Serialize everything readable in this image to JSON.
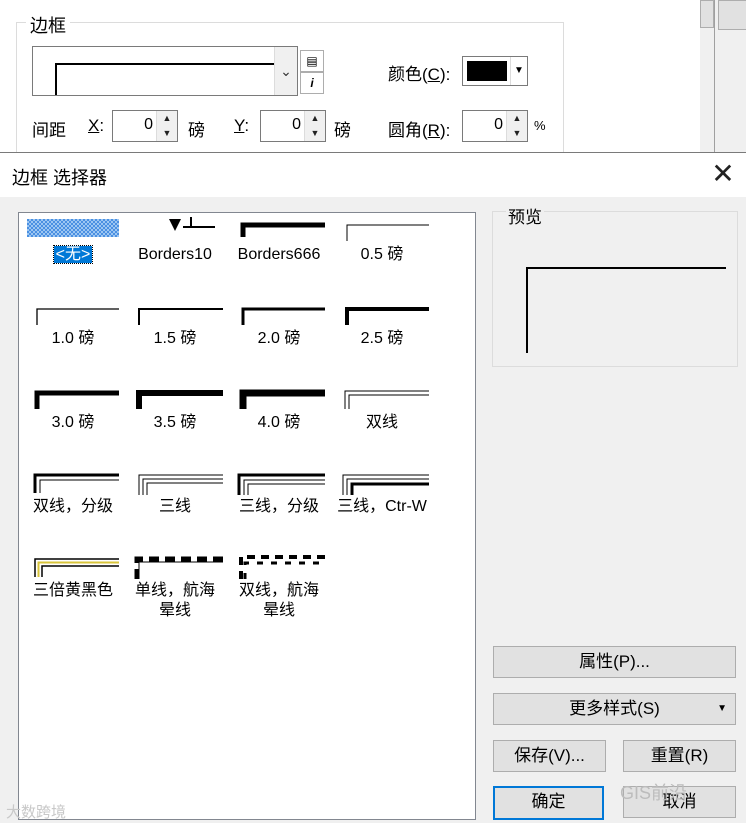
{
  "background_panel": {
    "group_title": "边框",
    "color_label": "颜色(",
    "color_key": "C",
    "color_suffix": "):",
    "color_value": "#000000",
    "spacing_label": "间距",
    "x_key": "X",
    "x_suffix": ":",
    "x_value": "0",
    "x_unit": "磅",
    "y_key": "Y",
    "y_suffix": ":",
    "y_value": "0",
    "y_unit": "磅",
    "corner_label": "圆角(",
    "corner_key": "R",
    "corner_suffix": "):",
    "corner_value": "0",
    "corner_unit": "%"
  },
  "dialog": {
    "title": "边框 选择器",
    "preview_label": "预览",
    "borders": [
      {
        "name": "<无>",
        "selected": true
      },
      {
        "name": "Borders10"
      },
      {
        "name": "Borders666"
      },
      {
        "name": "0.5 磅"
      },
      {
        "name": "1.0 磅"
      },
      {
        "name": "1.5 磅"
      },
      {
        "name": "2.0 磅"
      },
      {
        "name": "2.5 磅"
      },
      {
        "name": "3.0 磅"
      },
      {
        "name": "3.5 磅"
      },
      {
        "name": "4.0 磅"
      },
      {
        "name": "双线"
      },
      {
        "name": "双线，分级"
      },
      {
        "name": "三线"
      },
      {
        "name": "三线，分级"
      },
      {
        "name": "三线，Ctr-W"
      },
      {
        "name": "三倍黄黑色"
      },
      {
        "name": "单线，航海晕线"
      },
      {
        "name": "双线，航海晕线"
      }
    ],
    "buttons": {
      "properties": "属性(P)...",
      "more_styles": "更多样式(S)",
      "save": "保存(V)...",
      "reset": "重置(R)",
      "ok": "确定",
      "cancel": "取消"
    },
    "accent_color": "#0078d7"
  },
  "watermarks": {
    "left": "大数跨境",
    "right": "GIS前沿"
  }
}
